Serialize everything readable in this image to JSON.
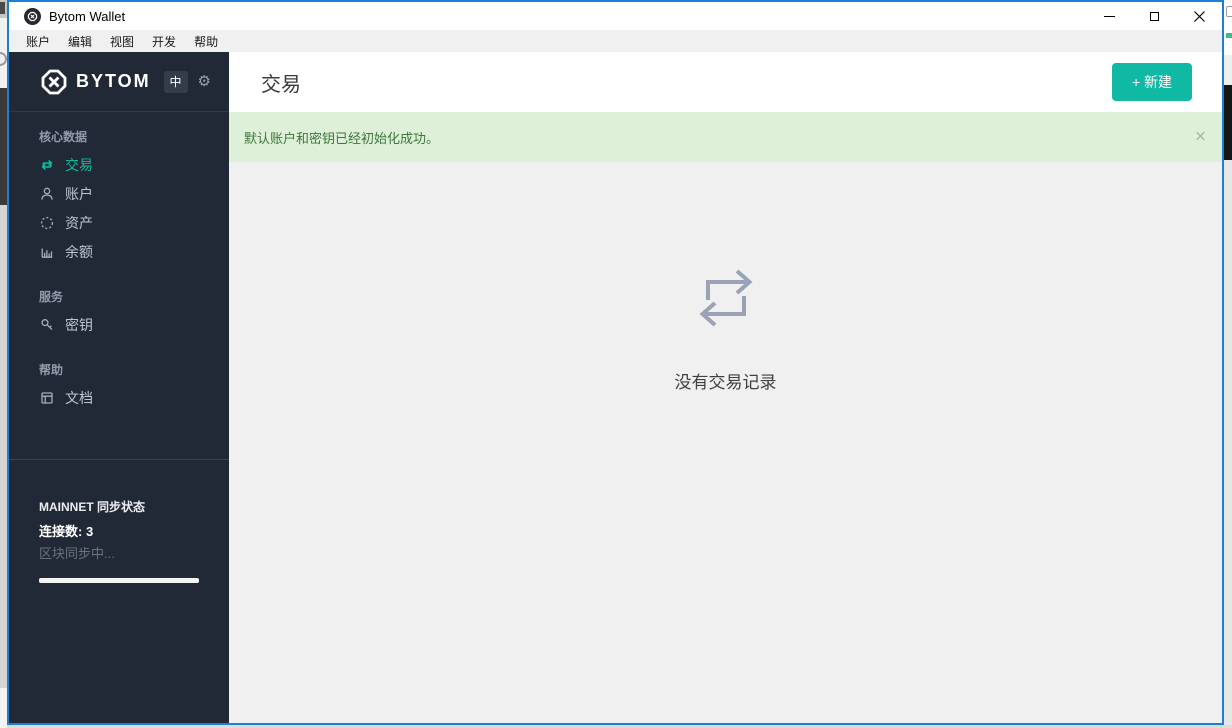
{
  "window": {
    "title": "Bytom Wallet"
  },
  "menu": {
    "items": [
      "账户",
      "编辑",
      "视图",
      "开发",
      "帮助"
    ]
  },
  "sidebar": {
    "brand": "BYTOM",
    "language_button": "中",
    "sections": [
      {
        "label": "核心数据",
        "items": [
          {
            "label": "交易",
            "icon": "swap-arrows-icon",
            "active": true
          },
          {
            "label": "账户",
            "icon": "person-icon",
            "active": false
          },
          {
            "label": "资产",
            "icon": "dotted-circle-icon",
            "active": false
          },
          {
            "label": "余额",
            "icon": "bar-chart-icon",
            "active": false
          }
        ]
      },
      {
        "label": "服务",
        "items": [
          {
            "label": "密钥",
            "icon": "key-icon",
            "active": false
          }
        ]
      },
      {
        "label": "帮助",
        "items": [
          {
            "label": "文档",
            "icon": "document-icon",
            "active": false
          }
        ]
      }
    ],
    "sync": {
      "network_label": "MAINNET 同步状态",
      "connections_label": "连接数:",
      "connections_value": "3",
      "status_text": "区块同步中...",
      "progress_percent": 100
    }
  },
  "main": {
    "page_title": "交易",
    "new_button_label": "+ 新建",
    "alert": {
      "message": "默认账户和密钥已经初始化成功。"
    },
    "empty_state": {
      "message": "没有交易记录"
    }
  },
  "icons": {
    "gear": "⚙",
    "alert_close": "×"
  },
  "colors": {
    "accent_button": "#10b9a4",
    "active_nav": "#04c0a0",
    "alert_bg": "#dff0d8",
    "alert_text": "#3c763d",
    "sidebar_bg": "#222936",
    "window_border": "#1c7fd5",
    "main_bg": "#f0f0f0"
  }
}
